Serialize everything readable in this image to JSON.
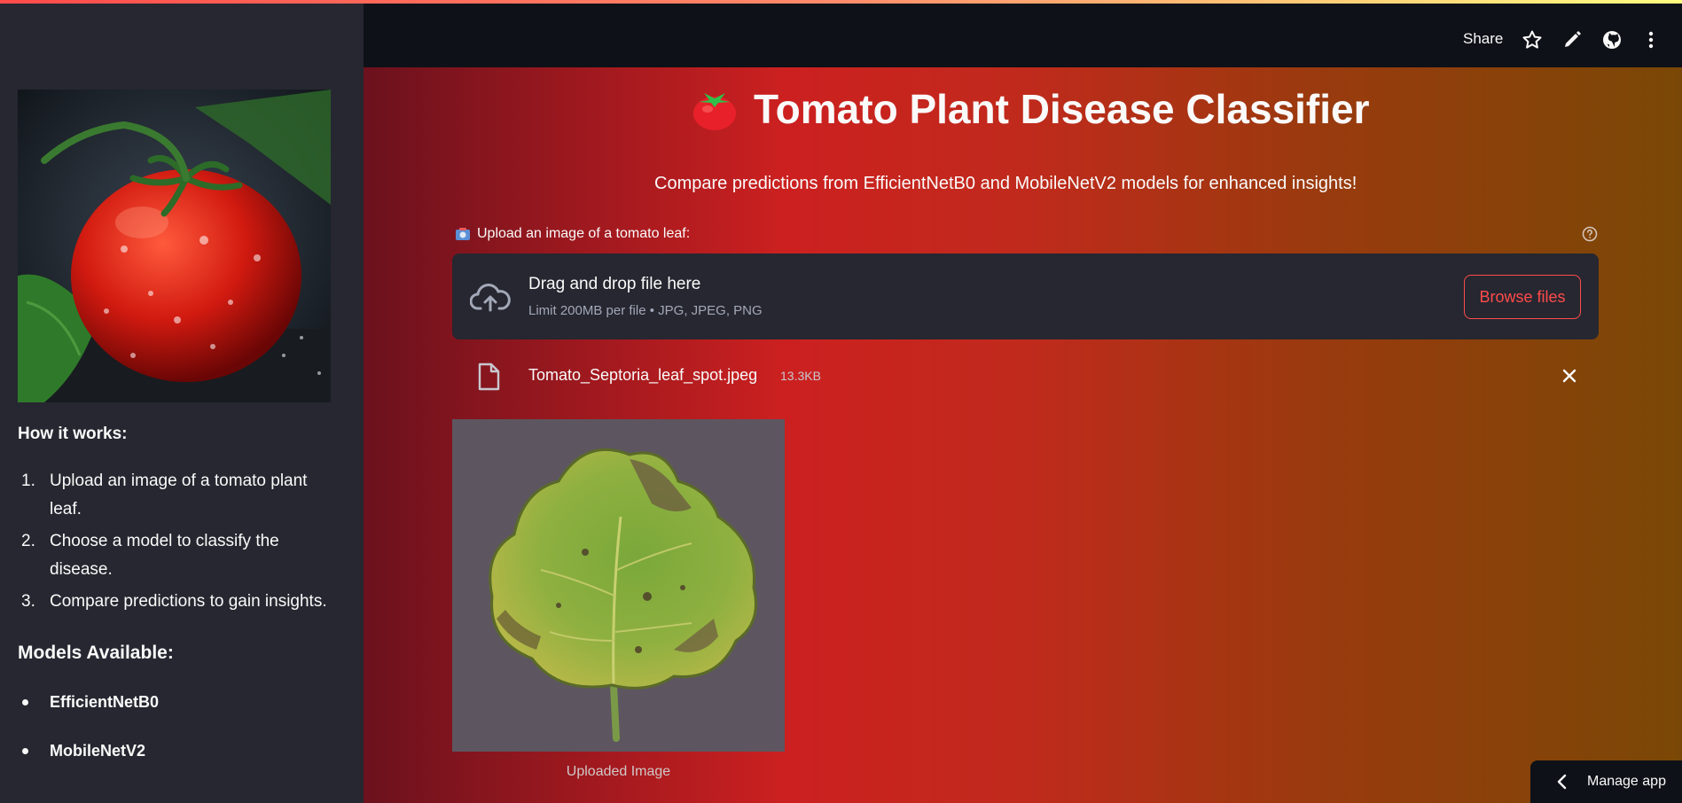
{
  "header": {
    "share_label": "Share",
    "icons": [
      "star-icon",
      "pencil-icon",
      "github-icon",
      "more-vertical-icon"
    ]
  },
  "sidebar": {
    "image_subject": "tomato",
    "how_it_works_heading": "How it works:",
    "steps": [
      {
        "num": "1.",
        "text": "Upload an image of a tomato plant leaf."
      },
      {
        "num": "2.",
        "text": "Choose a model to classify the disease."
      },
      {
        "num": "3.",
        "text": "Compare predictions to gain insights."
      }
    ],
    "models_heading": "Models Available:",
    "models": [
      "EfficientNetB0",
      "MobileNetV2"
    ]
  },
  "main": {
    "title": "Tomato Plant Disease Classifier",
    "title_icon": "tomato-icon",
    "subtitle": "Compare predictions from EfficientNetB0 and MobileNetV2 models for enhanced insights!",
    "upload": {
      "label": "Upload an image of a tomato leaf:",
      "dropzone_title": "Drag and drop file here",
      "dropzone_limit": "Limit 200MB per file • JPG, JPEG, PNG",
      "browse_label": "Browse files"
    },
    "file": {
      "name": "Tomato_Septoria_leaf_spot.jpeg",
      "size": "13.3KB"
    },
    "image_caption": "Uploaded Image"
  },
  "footer": {
    "manage_app_label": "Manage app"
  },
  "colors": {
    "accent": "#ff4b4b",
    "sidebar_bg": "#262730",
    "header_bg": "#0e1117",
    "gradient_start": "#6b111d",
    "gradient_mid": "#cc2020",
    "gradient_end": "#7a4806"
  }
}
